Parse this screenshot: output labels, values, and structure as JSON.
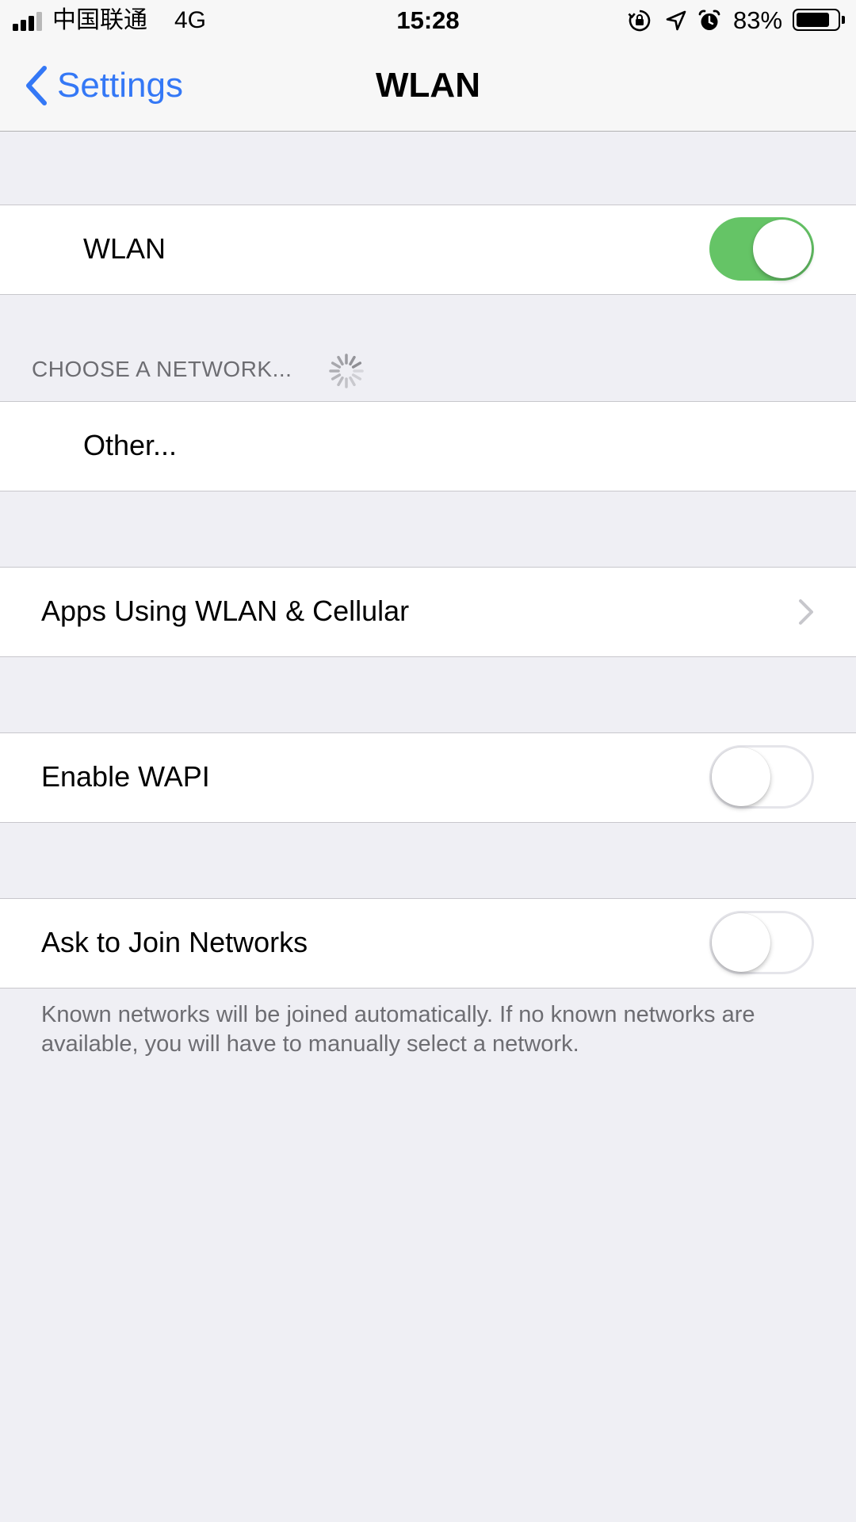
{
  "status_bar": {
    "carrier": "中国联通",
    "network": "4G",
    "time": "15:28",
    "battery_percent": "83%",
    "battery_level": 0.83,
    "icons": [
      "signal-icon",
      "orientation-lock-icon",
      "location-arrow-icon",
      "alarm-icon",
      "battery-icon"
    ]
  },
  "nav": {
    "back_label": "Settings",
    "title": "WLAN"
  },
  "wlan_row": {
    "label": "WLAN",
    "toggle_on": true
  },
  "networks": {
    "header": "CHOOSE A NETWORK...",
    "other_label": "Other..."
  },
  "apps_row": {
    "label": "Apps Using WLAN & Cellular"
  },
  "wapi_row": {
    "label": "Enable WAPI",
    "toggle_on": false
  },
  "ask_join_row": {
    "label": "Ask to Join Networks",
    "toggle_on": false,
    "footer": "Known networks will be joined automatically. If no known networks are available, you will have to manually select a network."
  },
  "colors": {
    "accent": "#3478f6",
    "toggle_on": "#65c466",
    "background": "#efeff4",
    "secondary_text": "#6d6d72"
  }
}
